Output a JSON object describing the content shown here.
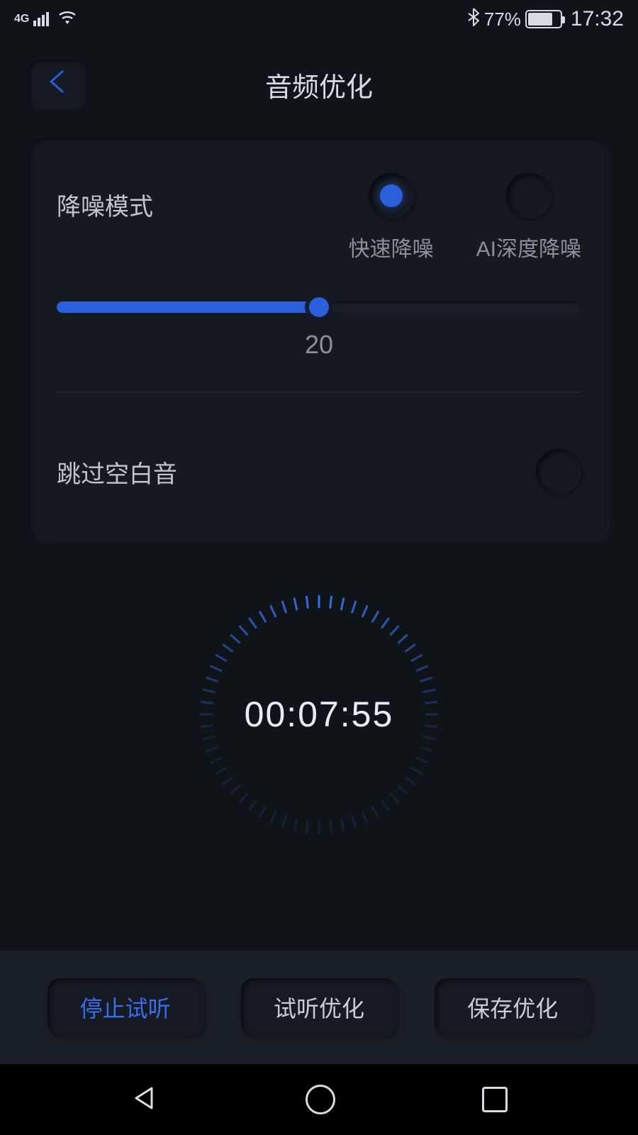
{
  "statusbar": {
    "network_type": "4G",
    "battery_percent": "77%",
    "time": "17:32"
  },
  "header": {
    "title": "音频优化"
  },
  "noise_reduction": {
    "label": "降噪模式",
    "options": [
      {
        "label": "快速降噪",
        "checked": true
      },
      {
        "label": "AI深度降噪",
        "checked": false
      }
    ],
    "slider_value": "20",
    "slider_percent": 50
  },
  "skip_silence": {
    "label": "跳过空白音",
    "checked": false
  },
  "timer": {
    "display": "00:07:55"
  },
  "actions": {
    "stop": "停止试听",
    "preview": "试听优化",
    "save": "保存优化"
  }
}
